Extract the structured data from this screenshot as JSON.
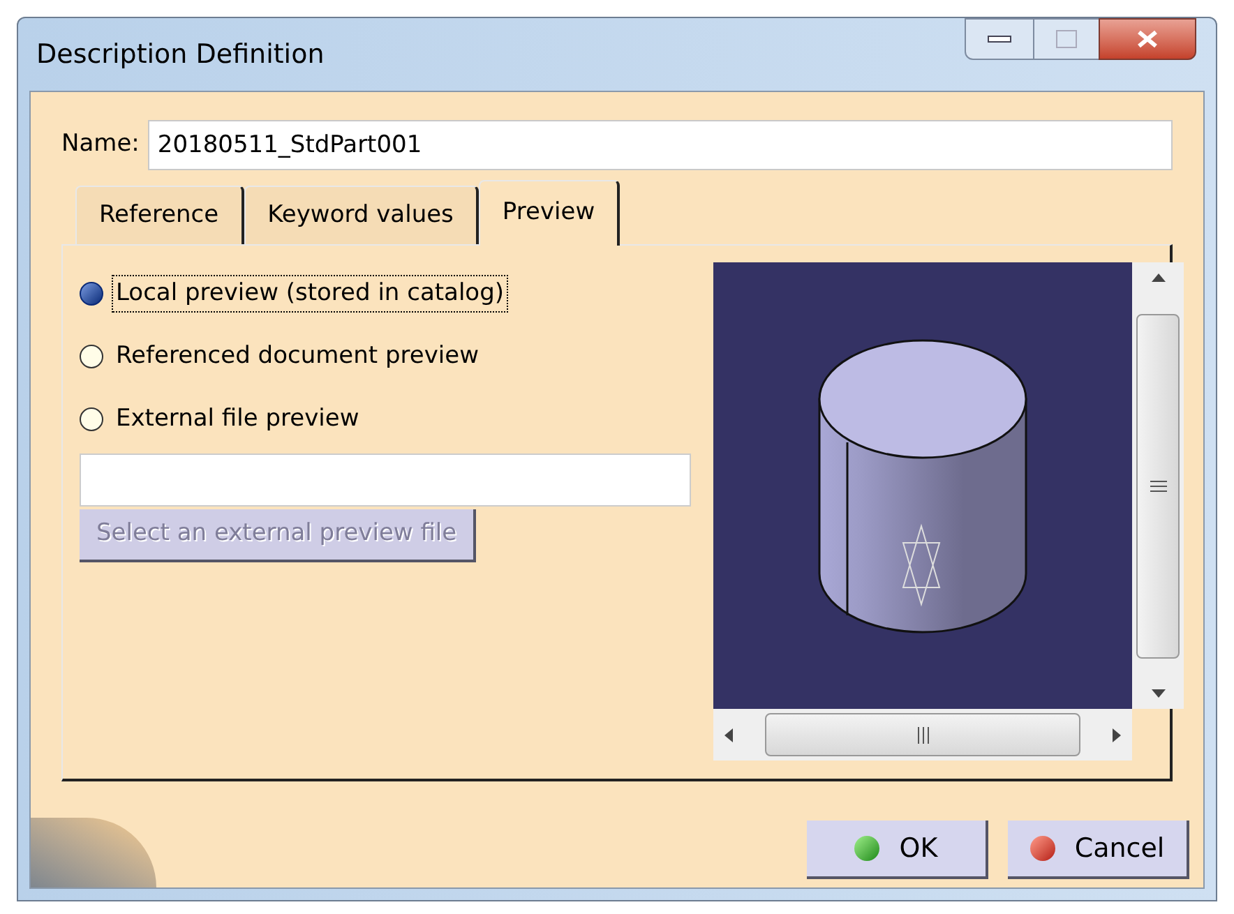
{
  "window": {
    "title": "Description Definition"
  },
  "name_field": {
    "label": "Name:",
    "value": "20180511_StdPart001"
  },
  "tabs": [
    {
      "label": "Reference",
      "selected": false
    },
    {
      "label": "Keyword values",
      "selected": false
    },
    {
      "label": "Preview",
      "selected": true
    }
  ],
  "preview_options": [
    {
      "label": "Local preview (stored in catalog)",
      "selected": true
    },
    {
      "label": "Referenced document preview",
      "selected": false
    },
    {
      "label": "External file preview",
      "selected": false
    }
  ],
  "select_file_button": {
    "label": "Select an external preview file",
    "disabled": true
  },
  "buttons": [
    {
      "label": "OK",
      "kind": "ok"
    },
    {
      "label": "Cancel",
      "kind": "cancel"
    }
  ]
}
